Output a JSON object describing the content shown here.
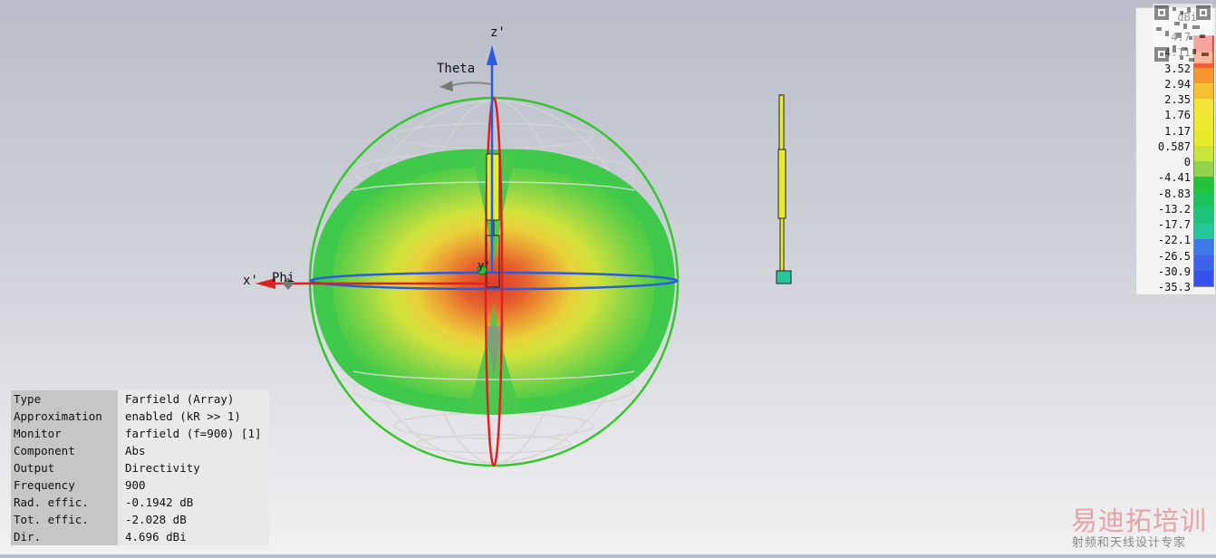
{
  "scene": {
    "axes": {
      "z": "z'",
      "x": "x'",
      "phi": "Phi",
      "theta": "Theta",
      "y": "y'"
    }
  },
  "legend": {
    "unit": "dBi",
    "ticks": [
      "4.7",
      "4.11",
      "3.52",
      "2.94",
      "2.35",
      "1.76",
      "1.17",
      "0.587",
      "0",
      "-4.41",
      "-8.83",
      "-13.2",
      "-17.7",
      "-22.1",
      "-26.5",
      "-30.9",
      "-35.3"
    ],
    "colors": [
      "#e8352b",
      "#f0602c",
      "#f5962e",
      "#f6c033",
      "#f3e43a",
      "#eeea33",
      "#e8ea2d",
      "#c8e63a",
      "#8fd44a",
      "#22c33a",
      "#1ac35b",
      "#1ec27a",
      "#25c79a",
      "#3f78e8",
      "#3b64ea",
      "#3552ee"
    ]
  },
  "info": [
    {
      "key": "Type",
      "value": "Farfield (Array)"
    },
    {
      "key": "Approximation",
      "value": "enabled (kR >> 1)"
    },
    {
      "key": "Monitor",
      "value": "farfield (f=900) [1]"
    },
    {
      "key": "Component",
      "value": "Abs"
    },
    {
      "key": "Output",
      "value": "Directivity"
    },
    {
      "key": "Frequency",
      "value": "900"
    },
    {
      "key": "Rad. effic.",
      "value": "-0.1942 dB"
    },
    {
      "key": "Tot. effic.",
      "value": "-2.028 dB"
    },
    {
      "key": "Dir.",
      "value": " 4.696 dBi"
    }
  ],
  "watermark": {
    "title": "易迪拓培训",
    "subtitle": "射频和天线设计专家"
  }
}
